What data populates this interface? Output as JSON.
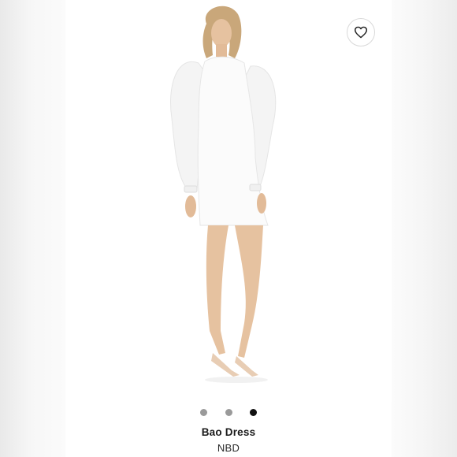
{
  "product": {
    "name": "Bao Dress",
    "brand": "NBD",
    "image_subject": "model-in-white-mini-dress"
  },
  "gallery": {
    "dots": [
      {
        "active": false
      },
      {
        "active": false
      },
      {
        "active": true
      }
    ]
  },
  "actions": {
    "favorite_icon": "heart-outline-icon"
  },
  "colors": {
    "background": "#ffffff",
    "dot_inactive": "#9a9a9a",
    "dot_active": "#111111",
    "text_primary": "#1a1a1a"
  }
}
